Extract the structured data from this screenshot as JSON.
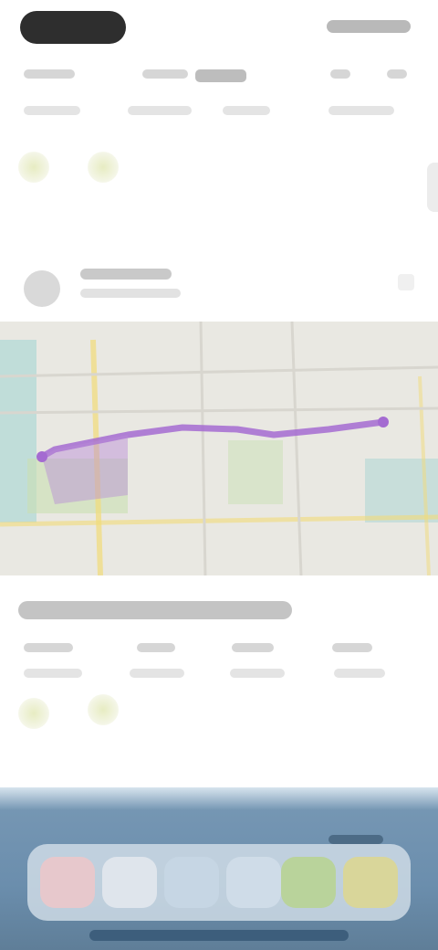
{
  "status_bar": {
    "pill_color": "#2e2e2e"
  },
  "stats_row": {
    "items": [
      {
        "icon": "stat-placeholder"
      },
      {
        "icon": "stat-placeholder"
      },
      {
        "icon": "stat-placeholder"
      },
      {
        "icon": "stat-placeholder"
      }
    ]
  },
  "route_section": {
    "avatar_icon": "route-avatar-icon",
    "chevron_icon": "chevron-right-icon"
  },
  "map": {
    "route_color": "#a46bd1",
    "water_color": "#9fd3d1",
    "park_color": "#c9dfb3",
    "road_color": "#f2dc7a"
  },
  "activity_section": {
    "items": [
      {
        "icon": "stat-placeholder"
      },
      {
        "icon": "stat-placeholder"
      },
      {
        "icon": "stat-placeholder"
      },
      {
        "icon": "stat-placeholder"
      }
    ]
  },
  "dock": {
    "apps": [
      {
        "icon": "app-icon-1",
        "color": "#e7c8cc"
      },
      {
        "icon": "app-icon-2",
        "color": "#dfe5ec"
      },
      {
        "icon": "app-icon-3",
        "color": "#c6d6e4"
      },
      {
        "icon": "app-icon-4",
        "color": "#cfdce8"
      },
      {
        "icon": "app-icon-5",
        "color": "#b9d39b"
      },
      {
        "icon": "app-icon-6",
        "color": "#d9d69a"
      }
    ]
  }
}
